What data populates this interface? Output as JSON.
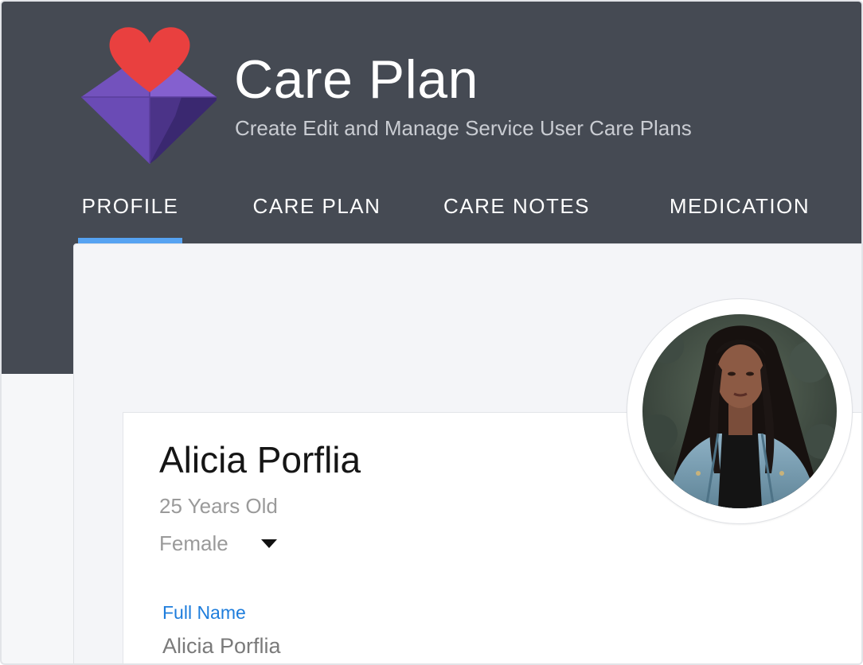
{
  "app": {
    "title": "Care Plan",
    "subtitle": "Create Edit and Manage Service User Care Plans",
    "logo_icon": "heart-envelope-logo"
  },
  "tabs": [
    {
      "label": "PROFILE",
      "active": true
    },
    {
      "label": "CARE PLAN",
      "active": false
    },
    {
      "label": "CARE NOTES",
      "active": false
    },
    {
      "label": "MEDICATION",
      "active": false
    }
  ],
  "profile": {
    "name": "Alicia Porflia",
    "age": "25 Years Old",
    "gender": "Female",
    "photo_icon": "profile-photo",
    "fields": [
      {
        "label": "Full Name",
        "value": "Alicia Porflia"
      }
    ]
  },
  "colors": {
    "header_bg": "#454a53",
    "tab_indicator": "#56a3f2",
    "field_label": "#1e7ddc",
    "heart": "#e9403f",
    "logo_purple": "#6a4bb5"
  }
}
